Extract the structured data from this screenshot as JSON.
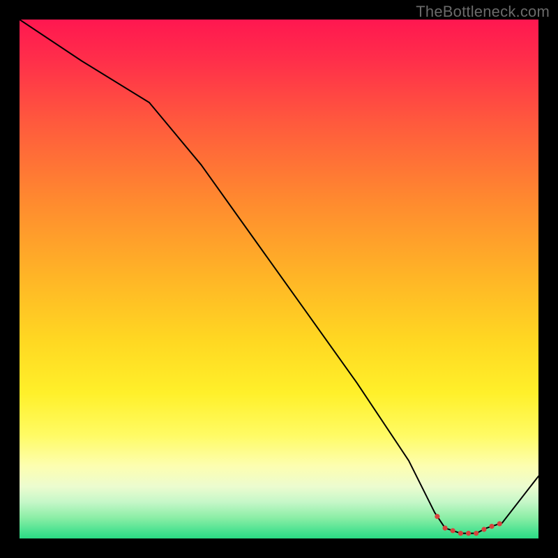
{
  "watermark": "TheBottleneck.com",
  "chart_data": {
    "type": "line",
    "title": "",
    "xlabel": "",
    "ylabel": "",
    "xlim": [
      0,
      100
    ],
    "ylim": [
      0,
      100
    ],
    "x": [
      0,
      12,
      25,
      35,
      45,
      55,
      65,
      75,
      80,
      82,
      85,
      88,
      90,
      93,
      100
    ],
    "values": [
      100,
      92,
      84,
      72,
      58,
      44,
      30,
      15,
      5,
      2,
      1,
      1,
      2,
      3,
      12
    ],
    "markers": {
      "x": [
        80.5,
        82,
        83.5,
        85,
        86.5,
        88,
        89.5,
        91,
        92.5
      ],
      "color": "#d6443d",
      "size": 3.6
    },
    "line_color": "#000000",
    "line_width": 2
  },
  "colors": {
    "background": "#000000",
    "watermark": "#6a6a6a",
    "gradient_top": "#ff1750",
    "gradient_bottom": "#2bdb84"
  }
}
